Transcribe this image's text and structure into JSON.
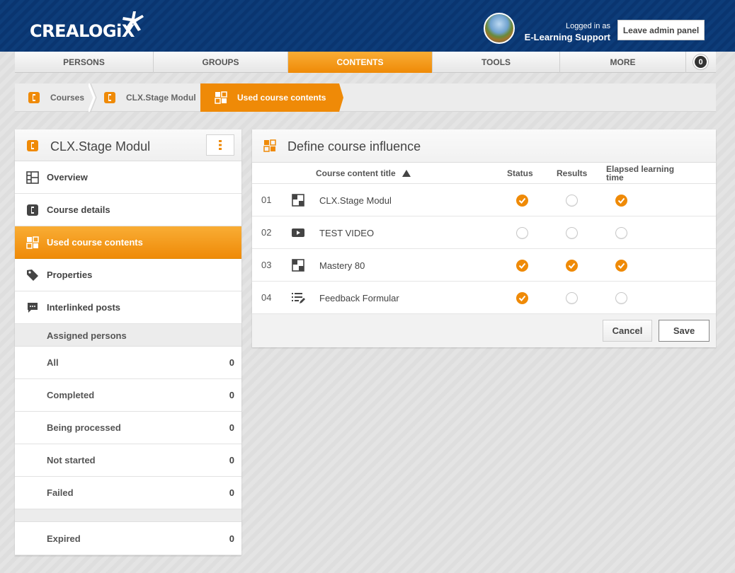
{
  "header": {
    "brand": "CREALOGiX",
    "logged_in_label": "Logged in as",
    "user_name": "E-Learning Support",
    "leave_button": "Leave admin panel"
  },
  "nav": {
    "items": [
      {
        "label": "PERSONS"
      },
      {
        "label": "GROUPS"
      },
      {
        "label": "CONTENTS",
        "active": true
      },
      {
        "label": "TOOLS"
      },
      {
        "label": "MORE"
      }
    ],
    "badge": "0"
  },
  "breadcrumb": [
    {
      "label": "Courses"
    },
    {
      "label": "CLX.Stage Modul"
    },
    {
      "label": "Used course contents",
      "active": true
    }
  ],
  "left_panel": {
    "title": "CLX.Stage Modul",
    "menu": [
      {
        "label": "Overview",
        "icon": "overview-icon"
      },
      {
        "label": "Course details",
        "icon": "course-icon"
      },
      {
        "label": "Used course contents",
        "icon": "content-icon",
        "active": true
      },
      {
        "label": "Properties",
        "icon": "tag-icon"
      },
      {
        "label": "Interlinked posts",
        "icon": "chat-icon"
      }
    ],
    "assigned_section": "Assigned persons",
    "counts": [
      {
        "label": "All",
        "count": "0"
      },
      {
        "label": "Completed",
        "count": "0"
      },
      {
        "label": "Being processed",
        "count": "0"
      },
      {
        "label": "Not started",
        "count": "0"
      },
      {
        "label": "Failed",
        "count": "0"
      }
    ],
    "expired": {
      "label": "Expired",
      "count": "0"
    }
  },
  "right_panel": {
    "title": "Define course influence",
    "columns": {
      "title": "Course content title",
      "status": "Status",
      "results": "Results",
      "elapsed_line1": "Elapsed learning",
      "elapsed_line2": "time"
    },
    "rows": [
      {
        "num": "01",
        "title": "CLX.Stage Modul",
        "icon": "module-icon",
        "status": true,
        "results": false,
        "elapsed": true
      },
      {
        "num": "02",
        "title": "TEST VIDEO",
        "icon": "video-icon",
        "status": false,
        "results": false,
        "elapsed": false
      },
      {
        "num": "03",
        "title": "Mastery 80",
        "icon": "module-icon",
        "status": true,
        "results": true,
        "elapsed": true
      },
      {
        "num": "04",
        "title": "Feedback Formular",
        "icon": "form-icon",
        "status": true,
        "results": false,
        "elapsed": false
      }
    ],
    "cancel_button": "Cancel",
    "save_button": "Save"
  },
  "colors": {
    "accent": "#ef8a07",
    "header_bg": "#0d3d7a"
  }
}
